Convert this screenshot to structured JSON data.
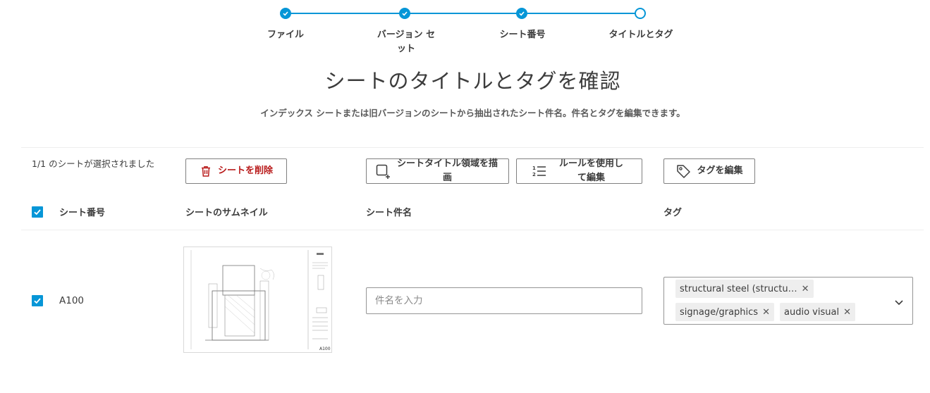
{
  "stepper": {
    "steps": [
      {
        "label": "ファイル",
        "state": "done"
      },
      {
        "label": "バージョン セット",
        "state": "done"
      },
      {
        "label": "シート番号",
        "state": "done"
      },
      {
        "label": "タイトルとタグ",
        "state": "current"
      }
    ],
    "color": "#0696d7"
  },
  "page": {
    "title": "シートのタイトルとタグを確認",
    "subtitle": "インデックス シートまたは旧バージョンのシートから抽出されたシート件名。件名とタグを編集できます。"
  },
  "toolbar": {
    "selection_status": "1/1 のシートが選択されました",
    "delete_label": "シートを削除",
    "draw_region_label": "シートタイトル領域を描画",
    "rule_edit_label": "ルールを使用して編集",
    "edit_tags_label": "タグを編集"
  },
  "table": {
    "columns": {
      "sheet_number": "シート番号",
      "thumbnail": "シートのサムネイル",
      "sheet_title": "シート件名",
      "tags": "タグ"
    },
    "rows": [
      {
        "checked": true,
        "sheet_number": "A100",
        "title_placeholder": "件名を入力",
        "title_value": "",
        "thumbnail_caption": "A100",
        "tags": [
          "structural steel (structu…",
          "signage/graphics",
          "audio visual"
        ]
      }
    ]
  },
  "colors": {
    "accent": "#0696d7",
    "delete": "#b91c1c"
  }
}
